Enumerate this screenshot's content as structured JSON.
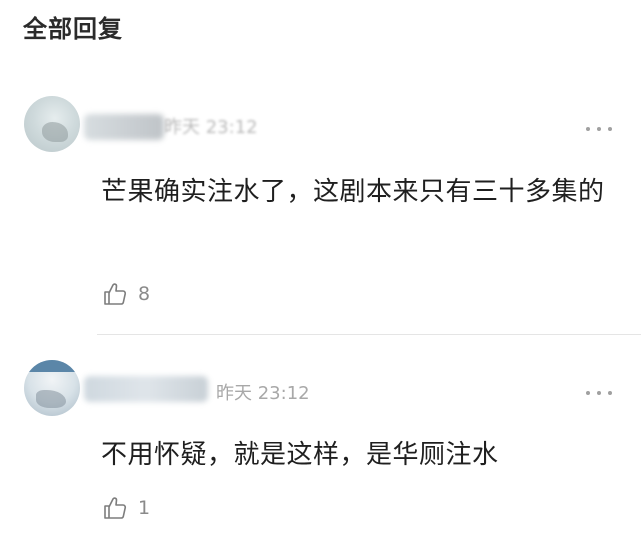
{
  "header": {
    "title": "全部回复"
  },
  "comments": [
    {
      "time": "昨天 23:12",
      "text": "芒果确实注水了，这剧本来只有三十多集的",
      "likes": "8"
    },
    {
      "time": "昨天 23:12",
      "text": "不用怀疑，就是这样，是华厕注水",
      "likes": "1"
    }
  ],
  "icons": {
    "like": "thumbs-up-outline-icon",
    "more": "more-horizontal-icon"
  },
  "colors": {
    "title": "#2b2b2b",
    "text": "#1f1f1f",
    "muted": "#a8a8a8",
    "divider": "#e5e5e5"
  }
}
